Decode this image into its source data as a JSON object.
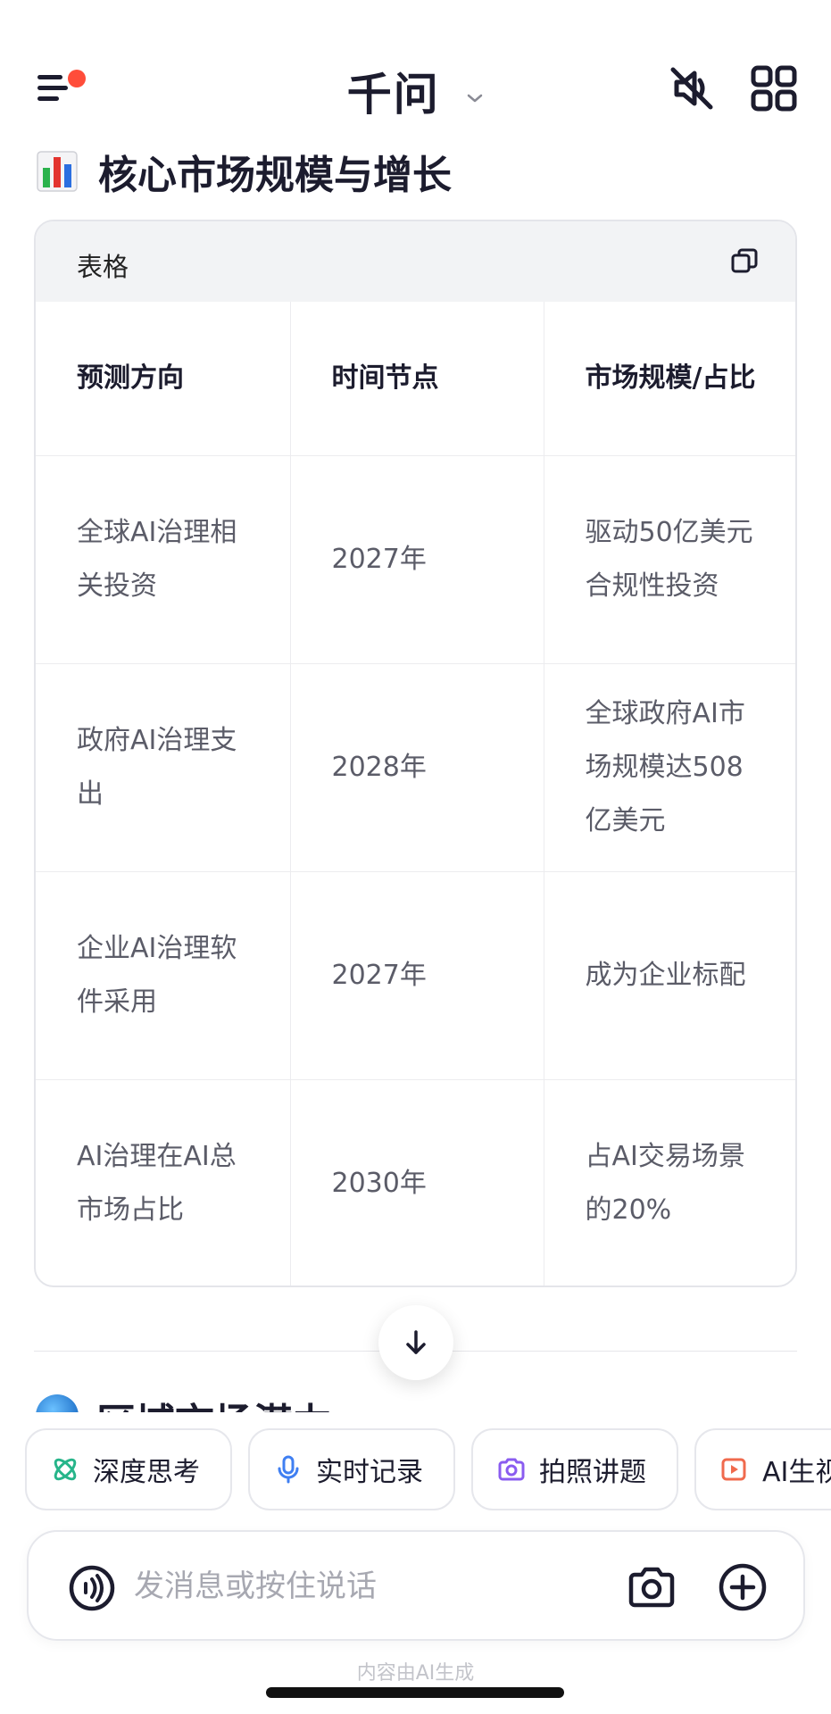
{
  "header": {
    "title": "千问",
    "menu_icon": "menu-icon",
    "mute_icon": "mute-icon",
    "grid_icon": "grid-icon",
    "badge_color": "#ff4d3a"
  },
  "section": {
    "icon": "bar-chart-icon",
    "title": "核心市场规模与增长"
  },
  "table": {
    "label": "表格",
    "copy_icon": "copy-icon",
    "headers": [
      "预测方向",
      "时间节点",
      "市场规模/占比"
    ],
    "rows": [
      [
        "全球AI治理相关投资",
        "2027年",
        "驱动50亿美元合规性投资"
      ],
      [
        "政府AI治理支出",
        "2028年",
        "全球政府AI市场规模达508亿美元"
      ],
      [
        "企业AI治理软件采用",
        "2027年",
        "成为企业标配"
      ],
      [
        "AI治理在AI总市场占比",
        "2030年",
        "占AI交易场景的20%"
      ]
    ]
  },
  "next_section": {
    "title": "区域市场潜力"
  },
  "chips": [
    {
      "label": "深度思考",
      "icon": "atom-icon",
      "color": "#27b58a"
    },
    {
      "label": "实时记录",
      "icon": "microphone-icon",
      "color": "#3f7ff2"
    },
    {
      "label": "拍照讲题",
      "icon": "camera-sparkle-icon",
      "color": "#8a5cf0"
    },
    {
      "label": "AI生视频",
      "icon": "video-icon",
      "color": "#f06a4d"
    }
  ],
  "input": {
    "placeholder": "发消息或按住说话",
    "voice_icon": "voice-icon",
    "camera_icon": "camera-icon",
    "plus_icon": "plus-icon"
  },
  "footer": {
    "note": "内容由AI生成"
  }
}
